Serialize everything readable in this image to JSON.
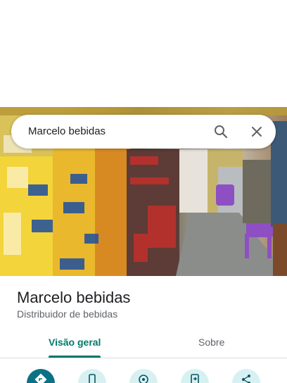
{
  "search": {
    "query": "Marcelo bebidas"
  },
  "place": {
    "name": "Marcelo bebidas",
    "category": "Distribuidor de bebidas"
  },
  "tabs": [
    {
      "label": "Visão geral",
      "active": true
    },
    {
      "label": "Sobre",
      "active": false
    }
  ],
  "actions": [
    {
      "icon": "directions-icon"
    },
    {
      "icon": "phone-icon"
    },
    {
      "icon": "location-icon"
    },
    {
      "icon": "send-to-phone-icon"
    },
    {
      "icon": "share-icon"
    }
  ],
  "colors": {
    "accent": "#00796b",
    "action_primary": "#0b7285",
    "action_secondary": "#d7f1f2"
  }
}
